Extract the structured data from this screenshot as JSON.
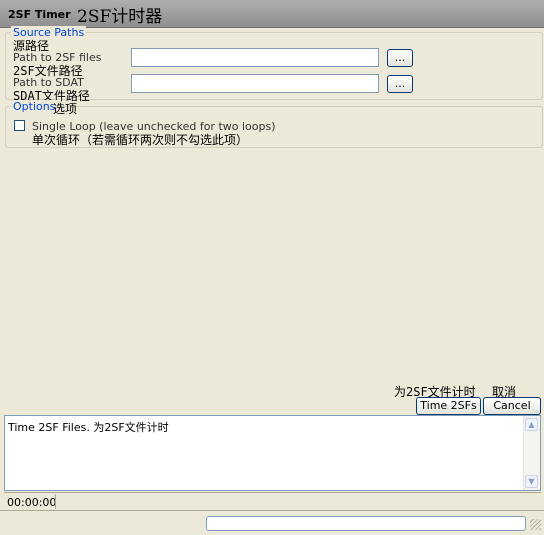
{
  "window": {
    "title": "2SF Timer",
    "title_zh": "2SF计时器"
  },
  "source_paths": {
    "legend": "Source Paths",
    "legend_zh": "源路径",
    "twosf_label": "Path to 2SF files",
    "twosf_label_zh": "2SF文件路径",
    "twosf_value": "",
    "twosf_browse": "...",
    "sdat_label": "Path to SDAT",
    "sdat_label_zh": "SDAT文件路径",
    "sdat_value": "",
    "sdat_browse": "..."
  },
  "options": {
    "legend": "Options",
    "legend_zh": "选项",
    "single_loop_label": "Single Loop (leave unchecked for two loops)",
    "single_loop_label_zh": "单次循环（若需循环两次则不勾选此项）",
    "single_loop_checked": false
  },
  "actions": {
    "time_label_zh": "为2SF文件计时",
    "cancel_label_zh": "取消",
    "time_button": "Time 2SFs",
    "cancel_button": "Cancel"
  },
  "log": {
    "text": "Time 2SF Files. 为2SF文件计时"
  },
  "status": {
    "elapsed": "00:00:00"
  }
}
